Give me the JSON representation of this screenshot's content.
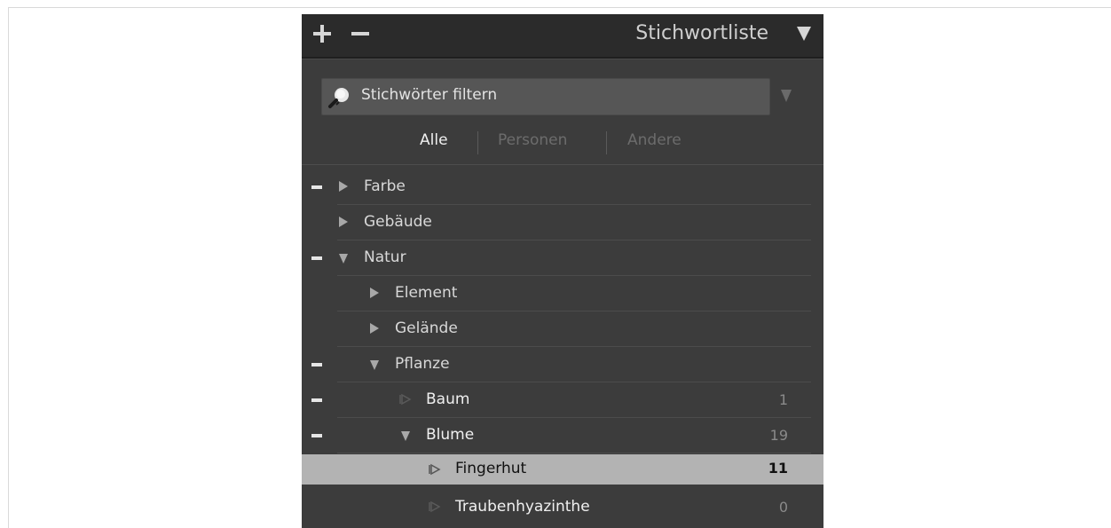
{
  "panel": {
    "title": "Stichwortliste",
    "add_icon": "plus-icon",
    "remove_icon": "minus-icon",
    "collapse_icon": "triangle-down-icon"
  },
  "filter": {
    "placeholder": "Stichwörter filtern",
    "icon": "search-icon",
    "dropdown_icon": "triangle-down-icon"
  },
  "tabs": [
    {
      "label": "Alle",
      "active": true
    },
    {
      "label": "Personen",
      "active": false
    },
    {
      "label": "Andere",
      "active": false
    }
  ],
  "keywords": [
    {
      "label": "Farbe",
      "count": "",
      "expanded": false,
      "has_minus": true
    },
    {
      "label": "Gebäude",
      "count": "",
      "expanded": false,
      "has_minus": false
    },
    {
      "label": "Natur",
      "count": "",
      "expanded": true,
      "has_minus": true
    },
    {
      "label": "Element",
      "count": "",
      "expanded": false,
      "has_minus": false
    },
    {
      "label": "Gelände",
      "count": "",
      "expanded": false,
      "has_minus": false
    },
    {
      "label": "Pflanze",
      "count": "",
      "expanded": true,
      "has_minus": true
    },
    {
      "label": "Baum",
      "count": "1",
      "expanded": false,
      "has_minus": true
    },
    {
      "label": "Blume",
      "count": "19",
      "expanded": true,
      "has_minus": true
    },
    {
      "label": "Fingerhut",
      "count": "11",
      "expanded": false,
      "has_minus": false,
      "selected": true
    },
    {
      "label": "Traubenhyazinthe",
      "count": "0",
      "expanded": false,
      "has_minus": false
    }
  ],
  "colors": {
    "panel_bg": "#3c3c3c",
    "header_bg": "#2b2b2b",
    "selected_row_bg": "#b3b3b3",
    "active_tab_text": "#f0f0f0",
    "inactive_tab_text": "#6c6c6c"
  }
}
